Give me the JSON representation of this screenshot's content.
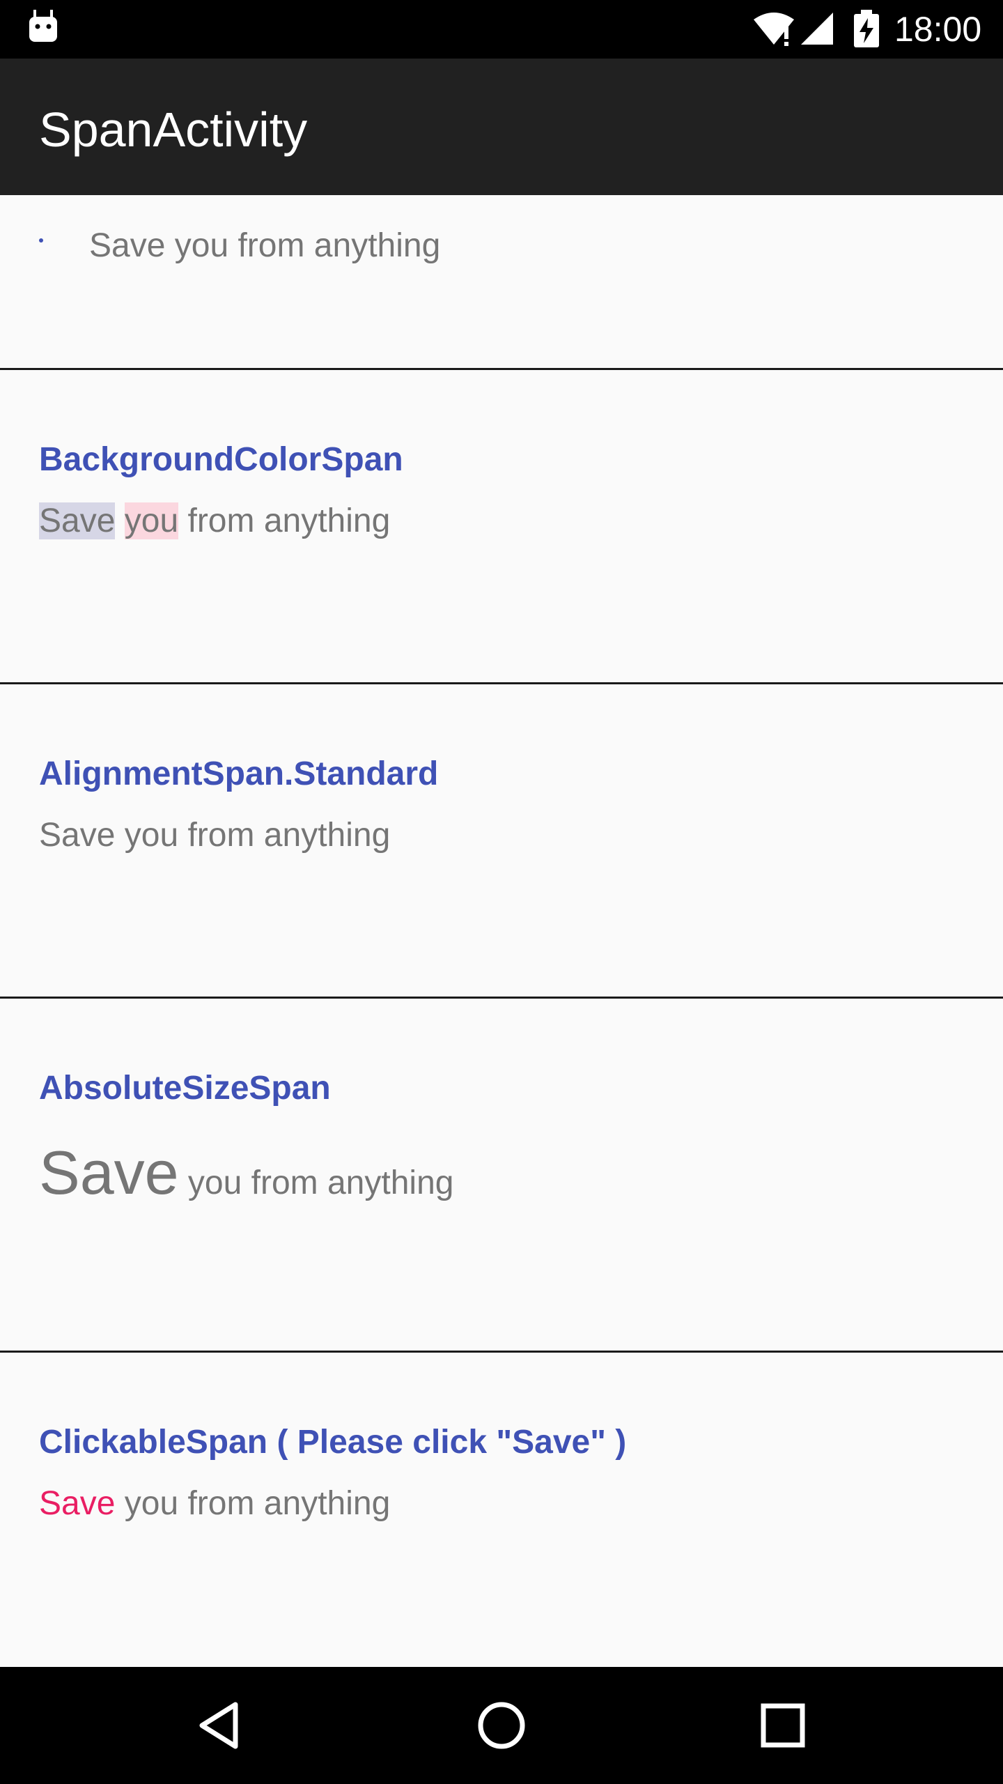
{
  "status_bar": {
    "time": "18:00",
    "icons": [
      "android-icon",
      "wifi-icon",
      "signal-icon",
      "battery-charging-icon"
    ]
  },
  "toolbar": {
    "title": "SpanActivity"
  },
  "sections": {
    "bullet": {
      "text": "Save you from anything"
    },
    "background_color": {
      "heading": "BackgroundColorSpan",
      "word1": "Save",
      "word2": "you",
      "rest": " from anything"
    },
    "alignment": {
      "heading": "AlignmentSpan.Standard",
      "text": "Save you from anything"
    },
    "absolute_size": {
      "heading": "AbsoluteSizeSpan",
      "big": "Save",
      "rest": " you from anything"
    },
    "clickable": {
      "heading": "ClickableSpan ( Please click \"Save\" )",
      "link": "Save",
      "rest": " you from anything"
    }
  },
  "nav_bar": {
    "icons": [
      "back-icon",
      "home-icon",
      "recents-icon"
    ]
  },
  "colors": {
    "heading": "#3f51b5",
    "body_text": "#757575",
    "link": "#e91e63",
    "toolbar": "#212121",
    "background": "#fafafa"
  }
}
